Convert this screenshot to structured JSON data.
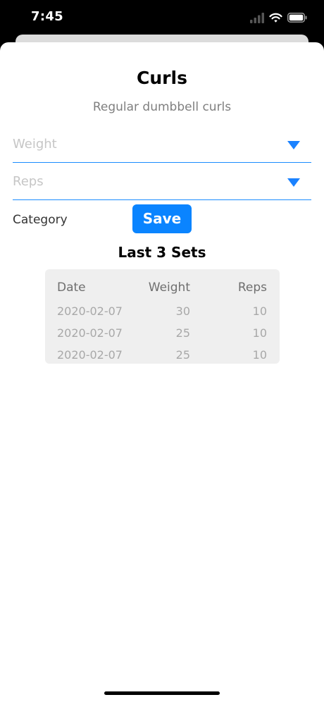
{
  "status_bar": {
    "time": "7:45",
    "icons": [
      "signal-icon",
      "wifi-icon",
      "battery-icon"
    ]
  },
  "exercise": {
    "title": "Curls",
    "subtitle": "Regular dumbbell curls"
  },
  "form": {
    "weight_placeholder": "Weight",
    "reps_placeholder": "Reps",
    "category_label": "Category",
    "save_label": "Save"
  },
  "last_sets": {
    "title": "Last 3 Sets",
    "columns": [
      "Date",
      "Weight",
      "Reps"
    ],
    "rows": [
      {
        "date": "2020-02-07",
        "weight": "30",
        "reps": "10"
      },
      {
        "date": "2020-02-07",
        "weight": "25",
        "reps": "10"
      },
      {
        "date": "2020-02-07",
        "weight": "25",
        "reps": "10"
      }
    ]
  },
  "colors": {
    "accent": "#0a84ff",
    "underline": "#1a8cff",
    "placeholder": "#c6c6c6",
    "table_bg": "#efefef"
  }
}
